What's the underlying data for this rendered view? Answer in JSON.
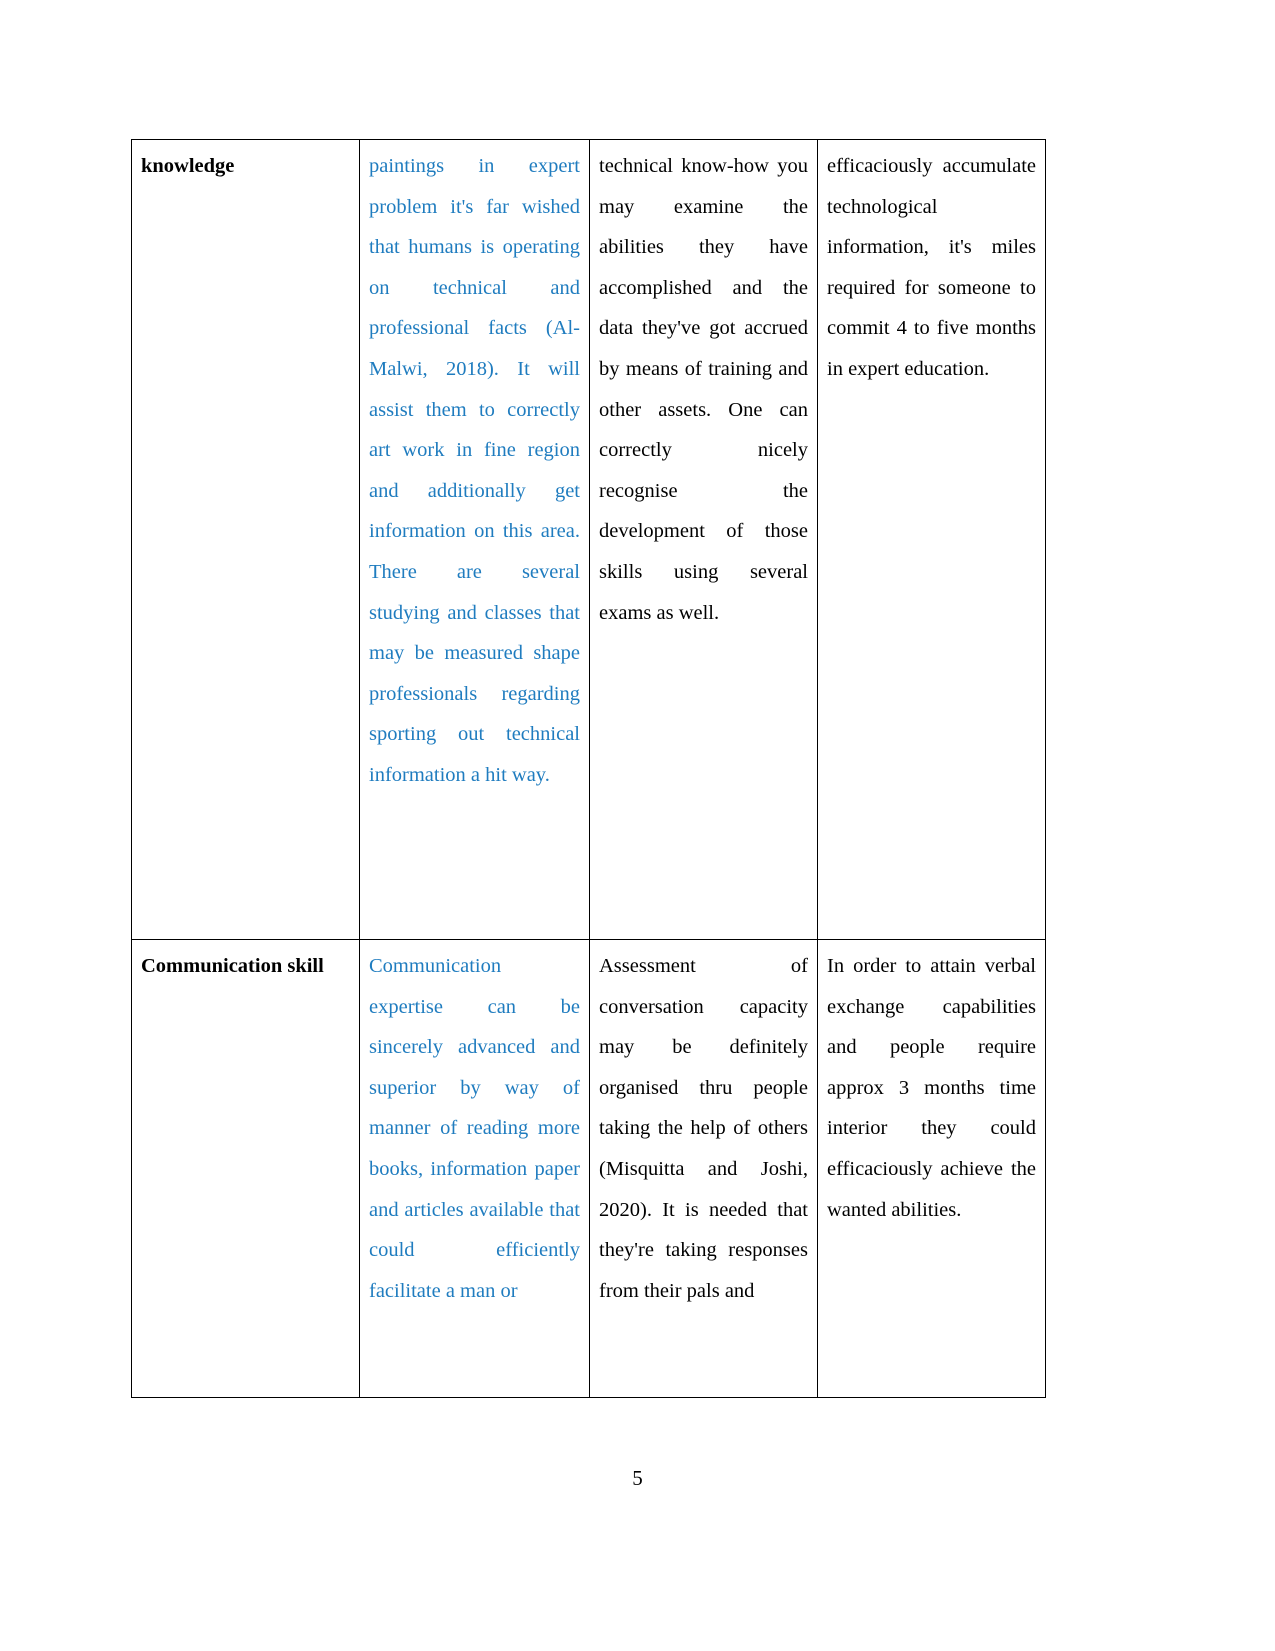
{
  "document": {
    "page_number": "5",
    "accent_blue": "#1f7cbf",
    "text_black": "#000000",
    "border_color": "#000000"
  },
  "table": {
    "columns": 4,
    "rows": [
      {
        "row_name": "knowledge-row",
        "cells": [
          {
            "name": "skill-label",
            "style": "bold-black",
            "text": "knowledge"
          },
          {
            "name": "development-method",
            "style": "blue",
            "text": "paintings in expert problem it's far wished that humans is operating on technical and professional facts (Al-Malwi, 2018). It will assist them to correctly art work in fine region and additionally get information on this area. There are several studying and classes that may be measured shape professionals regarding sporting out technical information a hit way."
          },
          {
            "name": "evaluation-criteria",
            "style": "black",
            "text": "technical know-how you may examine the abilities they have accomplished and the data they've got accrued by means of training and other assets. One can correctly nicely recognise the development of those skills using several exams as well."
          },
          {
            "name": "time-frame",
            "style": "black",
            "text": "efficaciously accumulate technological information, it's miles required for someone to commit 4 to five months in expert education."
          }
        ]
      },
      {
        "row_name": "communication-skill-row",
        "cells": [
          {
            "name": "skill-label",
            "style": "bold-black",
            "text": "Communication skill"
          },
          {
            "name": "development-method",
            "style": "blue",
            "text": "Communication expertise can be sincerely advanced and superior by way of manner of reading more books, information paper and articles available that could efficiently facilitate a man or"
          },
          {
            "name": "evaluation-criteria",
            "style": "black",
            "text": "Assessment of conversation capacity may be definitely organised thru people taking the help of others (Misquitta and Joshi, 2020). It is needed that they're taking responses from their pals and"
          },
          {
            "name": "time-frame",
            "style": "black",
            "text": "In order to attain verbal exchange capabilities and people require approx 3 months time interior they could efficaciously achieve the wanted abilities."
          }
        ]
      }
    ]
  }
}
